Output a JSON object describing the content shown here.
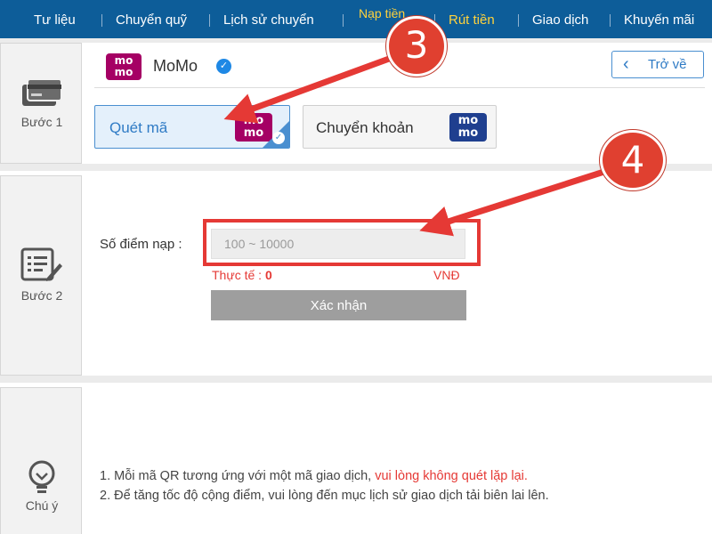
{
  "nav": {
    "items": [
      {
        "label": "Tư liệu"
      },
      {
        "label": "Chuyển quỹ"
      },
      {
        "label": "Lịch sử chuyển"
      },
      {
        "label": "Nạp tiền"
      },
      {
        "label": "Rút tiền"
      },
      {
        "label": "Giao dịch"
      },
      {
        "label": "Khuyến mãi"
      }
    ],
    "active_item": "Nạp tiền",
    "active_color": "#ffd23c",
    "bar_color": "#0d5d99"
  },
  "step1": {
    "label": "Bước 1",
    "icon": "card-icon",
    "provider_logo_text": "mo mo",
    "provider_name": "MoMo",
    "back_label": "Trở về",
    "methods": [
      {
        "label": "Quét mã",
        "selected": true
      },
      {
        "label": "Chuyển khoản",
        "selected": false
      }
    ]
  },
  "step2": {
    "label": "Bước 2",
    "icon": "form-edit-icon",
    "field_label": "Số điểm nạp :",
    "input_placeholder": "100 ~ 10000",
    "input_value": "",
    "actual_label": "Thực tế : ",
    "actual_value": "0",
    "currency": "VNĐ",
    "confirm_label": "Xác nhận"
  },
  "notes": {
    "label": "Chú ý",
    "icon": "lightbulb-icon",
    "items": [
      {
        "prefix": "1.  Mỗi mã QR tương ứng với một mã giao dịch, ",
        "warning": "vui lòng không quét lặp lại."
      },
      {
        "prefix": "2.  Để tăng tốc độ cộng điểm, vui lòng đến mục lịch sử giao dịch tải biên lai lên.",
        "warning": ""
      }
    ]
  },
  "annotations": {
    "callout_3": "3",
    "callout_4": "4",
    "color": "#e53935"
  },
  "colors": {
    "momo_brand": "#a50064",
    "accent_blue": "#2f7bc5",
    "warning_red": "#e53935"
  }
}
